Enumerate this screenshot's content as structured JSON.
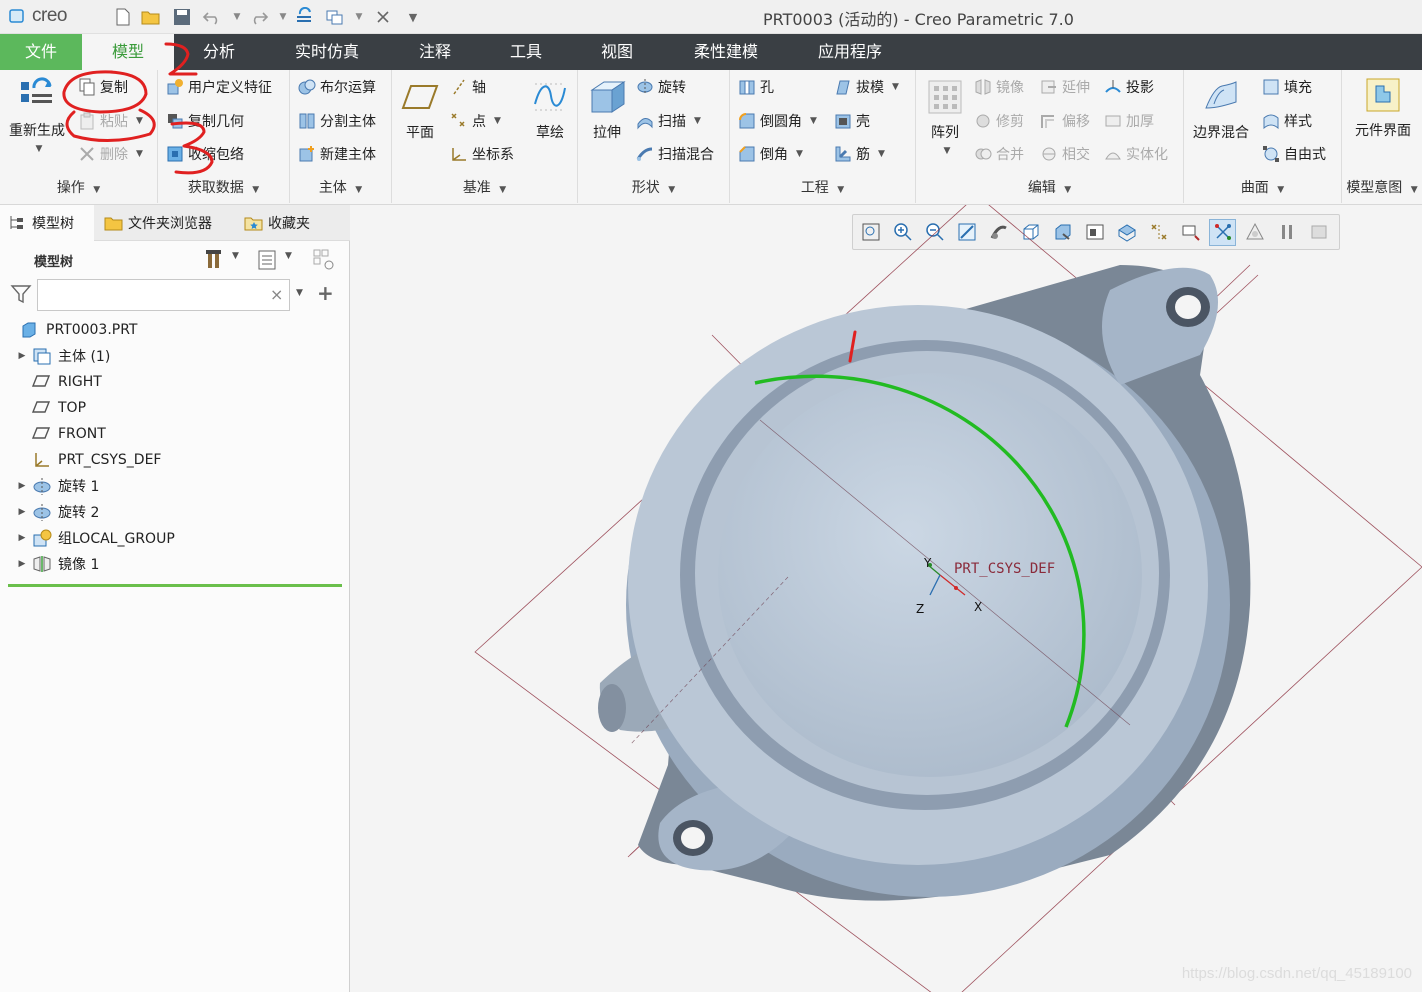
{
  "app": {
    "logo_text": "creo",
    "window_title": "PRT0003 (活动的) - Creo Parametric 7.0"
  },
  "tabs": [
    "文件",
    "模型",
    "分析",
    "实时仿真",
    "注释",
    "工具",
    "视图",
    "柔性建模",
    "应用程序"
  ],
  "ribbon": {
    "operations": {
      "label": "操作",
      "regenerate": "重新生成",
      "copy": "复制",
      "paste": "粘贴",
      "delete": "删除"
    },
    "get_data": {
      "label": "获取数据",
      "udf": "用户定义特征",
      "copy_geom": "复制几何",
      "shrinkwrap": "收缩包络"
    },
    "body": {
      "label": "主体",
      "boolean": "布尔运算",
      "split": "分割主体",
      "new_body": "新建主体"
    },
    "datum": {
      "label": "基准",
      "plane": "平面",
      "axis": "轴",
      "point": "点",
      "csys": "坐标系",
      "sketch": "草绘"
    },
    "shapes": {
      "label": "形状",
      "extrude": "拉伸",
      "revolve": "旋转",
      "sweep": "扫描",
      "swept_blend": "扫描混合"
    },
    "engineering": {
      "label": "工程",
      "hole": "孔",
      "round": "倒圆角",
      "chamfer": "倒角",
      "draft": "拔模",
      "shell": "壳",
      "rib": "筋"
    },
    "editing": {
      "label": "编辑",
      "pattern": "阵列",
      "mirror": "镜像",
      "extend": "延伸",
      "project": "投影",
      "trim": "修剪",
      "offset": "偏移",
      "thicken": "加厚",
      "merge": "合并",
      "intersect": "相交",
      "solidify": "实体化"
    },
    "surfaces": {
      "label": "曲面",
      "boundary_blend": "边界混合",
      "fill": "填充",
      "style": "样式",
      "freestyle": "自由式"
    },
    "model_intent": {
      "label": "模型意图",
      "component_interface": "元件界面"
    }
  },
  "left_panel": {
    "tabs": [
      "模型树",
      "文件夹浏览器",
      "收藏夹"
    ],
    "tree_header": "模型树",
    "filter_placeholder": "",
    "tree": [
      {
        "label": "PRT0003.PRT",
        "icon": "part-icon",
        "expandable": false,
        "indent": 0
      },
      {
        "label": "主体 (1)",
        "icon": "body-icon",
        "expandable": true,
        "indent": 1
      },
      {
        "label": "RIGHT",
        "icon": "datum-plane-icon",
        "expandable": false,
        "indent": 1
      },
      {
        "label": "TOP",
        "icon": "datum-plane-icon",
        "expandable": false,
        "indent": 1
      },
      {
        "label": "FRONT",
        "icon": "datum-plane-icon",
        "expandable": false,
        "indent": 1
      },
      {
        "label": "PRT_CSYS_DEF",
        "icon": "csys-icon",
        "expandable": false,
        "indent": 1
      },
      {
        "label": "旋转 1",
        "icon": "revolve-icon",
        "expandable": true,
        "indent": 1
      },
      {
        "label": "旋转 2",
        "icon": "revolve-icon",
        "expandable": true,
        "indent": 1
      },
      {
        "label": "组LOCAL_GROUP",
        "icon": "group-icon",
        "expandable": true,
        "indent": 1
      },
      {
        "label": "镜像 1",
        "icon": "mirror-icon",
        "expandable": true,
        "indent": 1
      }
    ]
  },
  "viewport": {
    "csys_label": "PRT_CSYS_DEF",
    "axis_x": "X",
    "axis_y": "Y",
    "axis_z": "Z",
    "watermark": "https://blog.csdn.net/qq_45189100"
  },
  "colors": {
    "accent_green": "#5cb85c",
    "tab_bar": "#3a3f44",
    "edge_highlight": "#22bb22",
    "annotation_red": "#e02020",
    "model_fill": "#b4c2d2"
  }
}
